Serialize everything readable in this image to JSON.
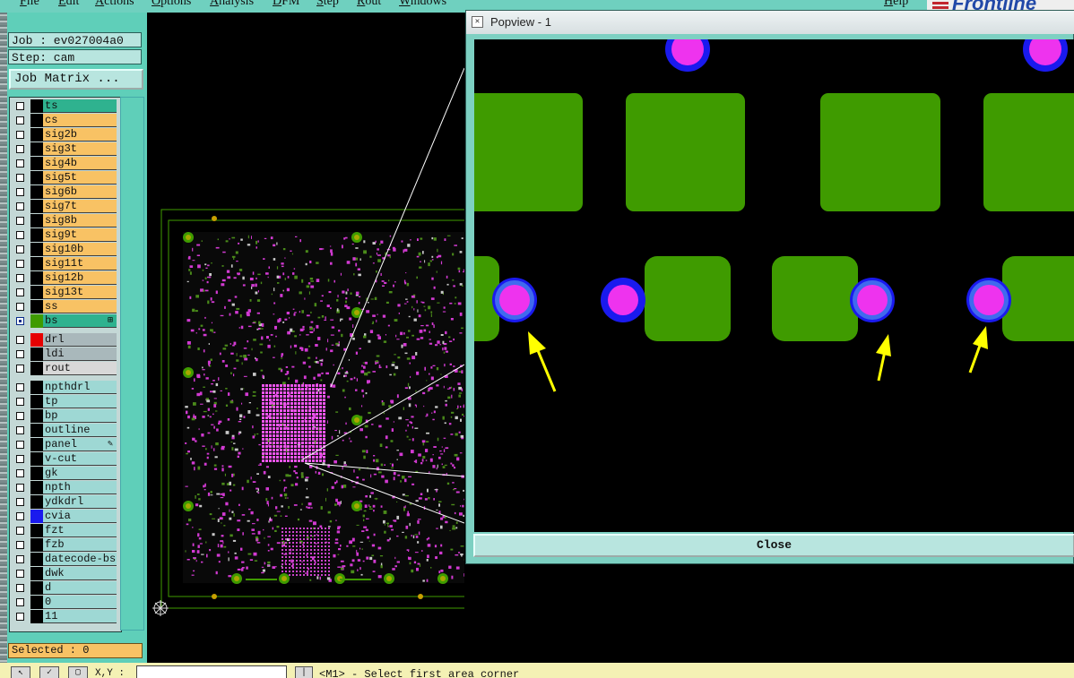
{
  "menu": {
    "items": [
      "File",
      "Edit",
      "Actions",
      "Options",
      "Analysis",
      "DFM",
      "Step",
      "Rout",
      "Windows"
    ],
    "help": "Help",
    "brand": "Frontline"
  },
  "job": {
    "job_label": "Job : ev027004a0",
    "step_label": "Step: cam",
    "matrix_button": "Job Matrix ..."
  },
  "colors": {
    "panel_teal": "#5fcfb9",
    "layer_orange": "#f8c264",
    "layer_cyan": "#9ed8d4",
    "layer_active": "#2fb28f",
    "layer_gray": "#a9b8bb",
    "pad_green": "#3f9b00",
    "via_magenta": "#ee33ee",
    "via_blue": "#1a1aee",
    "arrow_yellow": "#ffff00"
  },
  "layers": [
    {
      "name": "ts",
      "group": "active",
      "swatch": "",
      "checked": false
    },
    {
      "name": "cs",
      "group": "board",
      "swatch": "",
      "checked": false
    },
    {
      "name": "sig2b",
      "group": "board",
      "swatch": "",
      "checked": false
    },
    {
      "name": "sig3t",
      "group": "board",
      "swatch": "",
      "checked": false
    },
    {
      "name": "sig4b",
      "group": "board",
      "swatch": "",
      "checked": false
    },
    {
      "name": "sig5t",
      "group": "board",
      "swatch": "",
      "checked": false
    },
    {
      "name": "sig6b",
      "group": "board",
      "swatch": "",
      "checked": false
    },
    {
      "name": "sig7t",
      "group": "board",
      "swatch": "",
      "checked": false
    },
    {
      "name": "sig8b",
      "group": "board",
      "swatch": "",
      "checked": false
    },
    {
      "name": "sig9t",
      "group": "board",
      "swatch": "",
      "checked": false
    },
    {
      "name": "sig10b",
      "group": "board",
      "swatch": "",
      "checked": false
    },
    {
      "name": "sig11t",
      "group": "board",
      "swatch": "",
      "checked": false
    },
    {
      "name": "sig12b",
      "group": "board",
      "swatch": "",
      "checked": false
    },
    {
      "name": "sig13t",
      "group": "board",
      "swatch": "",
      "checked": false
    },
    {
      "name": "ss",
      "group": "board",
      "swatch": "",
      "checked": false
    },
    {
      "name": "bs",
      "group": "active",
      "swatch": "#3f9b00",
      "checked": true,
      "mark": "⊞"
    },
    {
      "name": "drl",
      "group": "drill",
      "swatch": "#e60000",
      "checked": false
    },
    {
      "name": "ldi",
      "group": "drill",
      "swatch": "",
      "checked": false
    },
    {
      "name": "rout",
      "group": "rout",
      "swatch": "",
      "checked": false
    },
    {
      "name": "npthdrl",
      "group": "misc",
      "swatch": "",
      "checked": false
    },
    {
      "name": "tp",
      "group": "misc",
      "swatch": "",
      "checked": false
    },
    {
      "name": "bp",
      "group": "misc",
      "swatch": "",
      "checked": false
    },
    {
      "name": "outline",
      "group": "misc",
      "swatch": "",
      "checked": false
    },
    {
      "name": "panel",
      "group": "misc",
      "swatch": "",
      "checked": false,
      "mark": "✎"
    },
    {
      "name": "v-cut",
      "group": "misc",
      "swatch": "",
      "checked": false
    },
    {
      "name": "gk",
      "group": "misc",
      "swatch": "",
      "checked": false
    },
    {
      "name": "npth",
      "group": "misc",
      "swatch": "",
      "checked": false
    },
    {
      "name": "ydkdrl",
      "group": "misc",
      "swatch": "",
      "checked": false
    },
    {
      "name": "cvia",
      "group": "misc",
      "swatch": "#1a1aee",
      "checked": false
    },
    {
      "name": "fzt",
      "group": "misc",
      "swatch": "",
      "checked": false
    },
    {
      "name": "fzb",
      "group": "misc",
      "swatch": "",
      "checked": false
    },
    {
      "name": "datecode-bs",
      "group": "misc",
      "swatch": "",
      "checked": false
    },
    {
      "name": "dwk",
      "group": "misc",
      "swatch": "",
      "checked": false
    },
    {
      "name": "d",
      "group": "misc",
      "swatch": "",
      "checked": false
    },
    {
      "name": "0",
      "group": "misc",
      "swatch": "",
      "checked": false
    },
    {
      "name": "11",
      "group": "misc",
      "swatch": "",
      "checked": false
    }
  ],
  "selected_label": "Selected : 0",
  "status": {
    "xy_label": "X,Y :",
    "message": "<M1> - Select first area corner"
  },
  "popview": {
    "title": "Popview - 1",
    "close_label": "Close"
  }
}
